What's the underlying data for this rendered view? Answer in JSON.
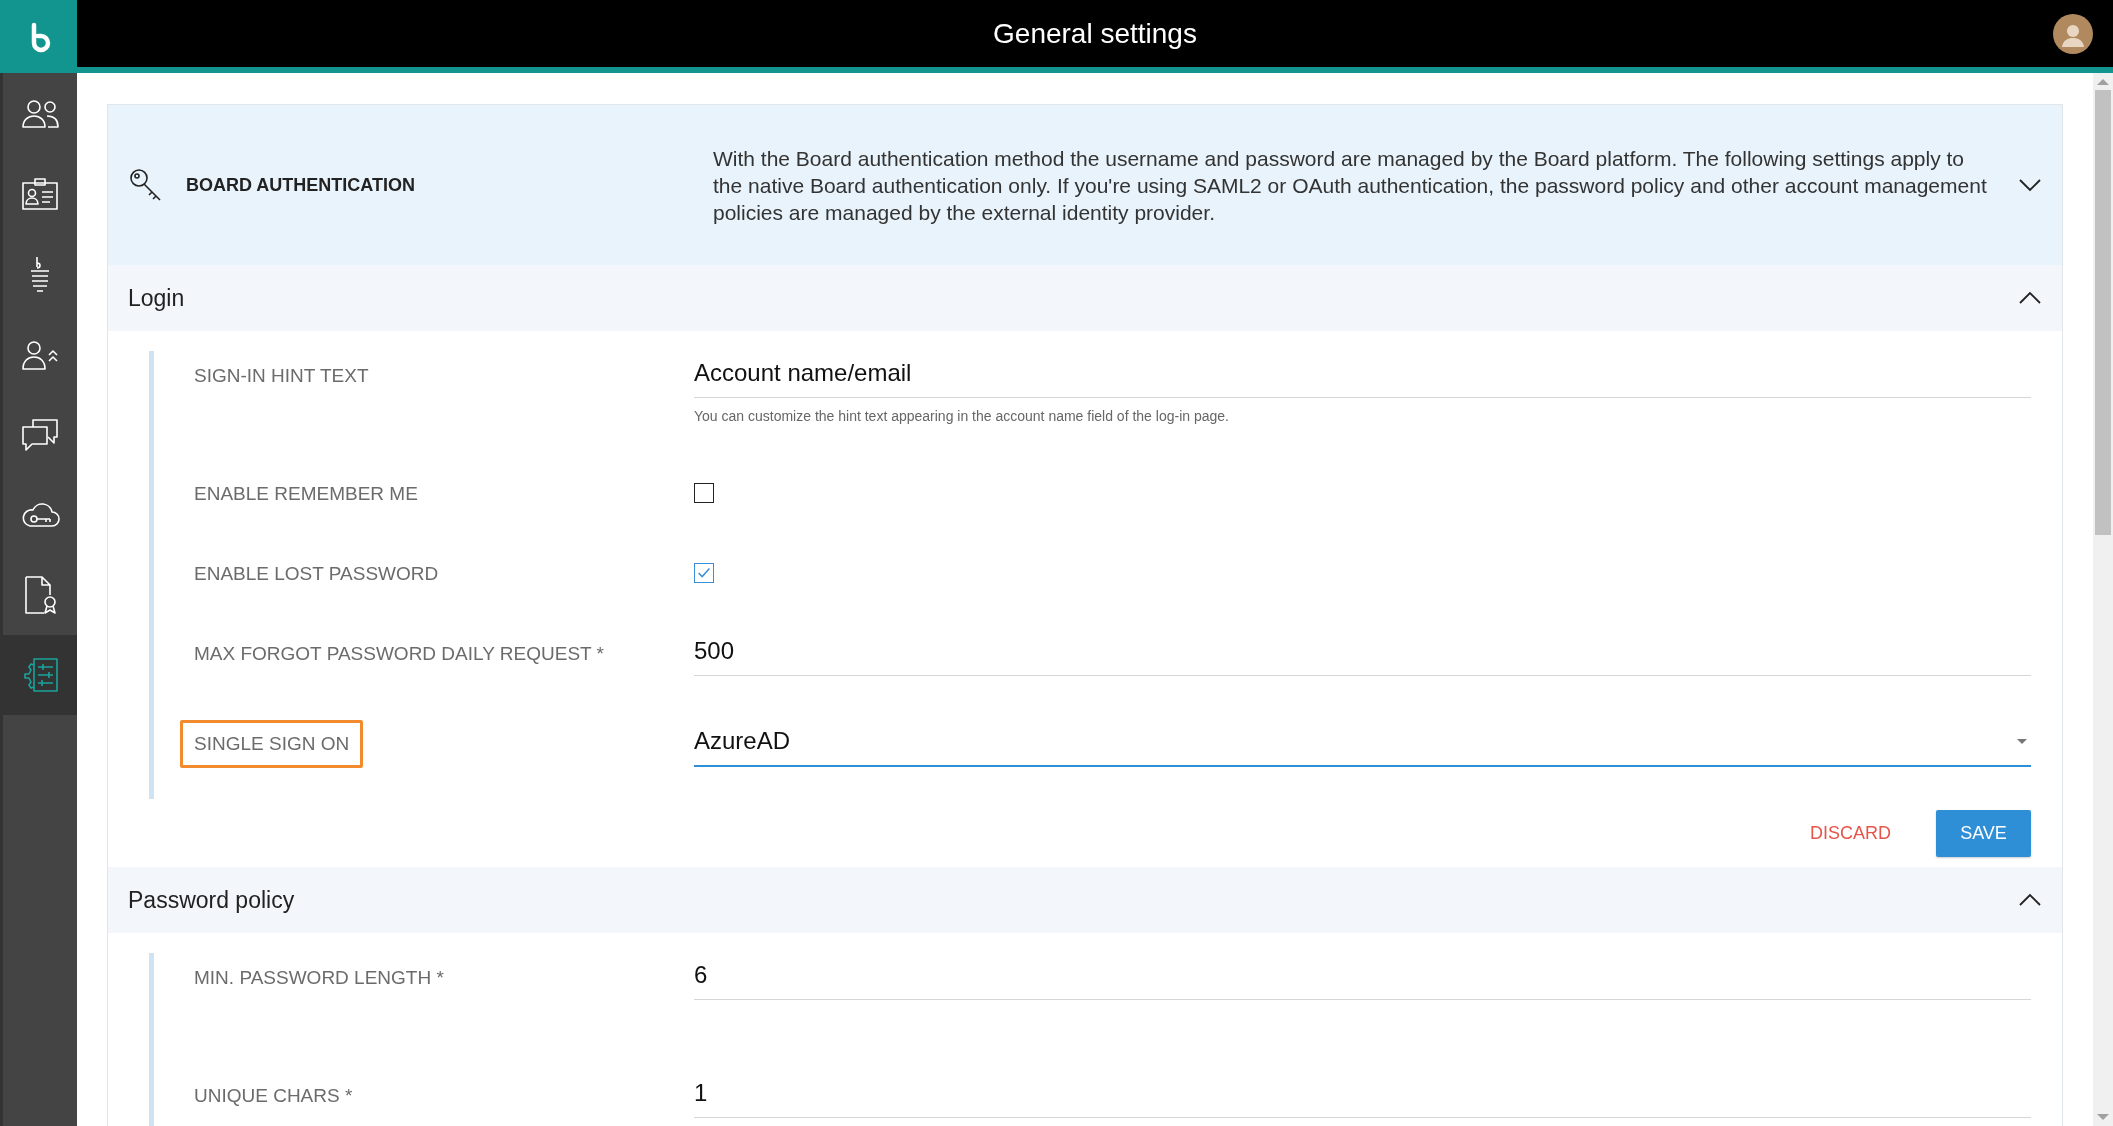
{
  "header": {
    "title": "General settings"
  },
  "sidebar": {
    "items": [
      {
        "kind": "users",
        "selected": false
      },
      {
        "kind": "idcard",
        "selected": false
      },
      {
        "kind": "stack",
        "selected": false
      },
      {
        "kind": "promote",
        "selected": false
      },
      {
        "kind": "chat",
        "selected": false
      },
      {
        "kind": "cloudkey",
        "selected": false
      },
      {
        "kind": "certificate",
        "selected": false
      },
      {
        "kind": "settings",
        "selected": true
      }
    ]
  },
  "auth_panel": {
    "title": "BOARD AUTHENTICATION",
    "description": "With the Board authentication method the username and password are managed by the Board platform. The following settings apply to the native Board authentication only. If you're using SAML2 or OAuth authentication, the password policy and other account management policies are managed by the external identity provider.",
    "expanded": false
  },
  "sections": [
    {
      "title": "Login",
      "expanded": true,
      "rows": [
        {
          "kind": "text",
          "label": "SIGN-IN HINT TEXT",
          "value": "Account name/email",
          "help": "You can customize the hint text appearing in the account name field of the log-in page."
        },
        {
          "kind": "checkbox",
          "label": "ENABLE REMEMBER ME",
          "checked": false
        },
        {
          "kind": "checkbox",
          "label": "ENABLE LOST PASSWORD",
          "checked": true
        },
        {
          "kind": "text",
          "label": "MAX FORGOT PASSWORD DAILY REQUEST *",
          "value": "500"
        },
        {
          "kind": "select",
          "label": "SINGLE SIGN ON",
          "value": "AzureAD",
          "focused": true,
          "highlighted": true
        }
      ],
      "actions": {
        "discard": "DISCARD",
        "save": "SAVE"
      }
    },
    {
      "title": "Password policy",
      "expanded": true,
      "rows": [
        {
          "kind": "text",
          "label": "MIN. PASSWORD LENGTH *",
          "value": "6"
        },
        {
          "kind": "text",
          "label": "UNIQUE CHARS *",
          "value": "1"
        }
      ]
    }
  ]
}
